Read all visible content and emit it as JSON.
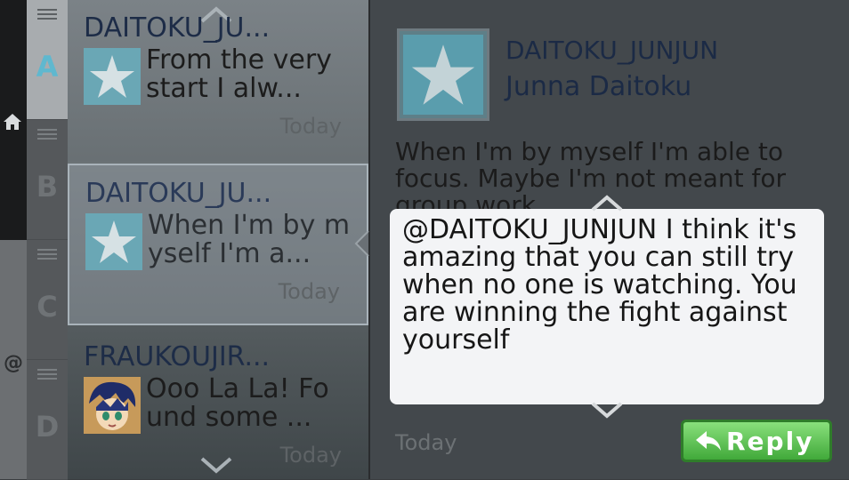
{
  "rail": {
    "home_icon": "home-icon",
    "at_label": "@"
  },
  "tabs": [
    {
      "letter": "A",
      "active": true
    },
    {
      "letter": "B",
      "active": false
    },
    {
      "letter": "C",
      "active": false
    },
    {
      "letter": "D",
      "active": false
    }
  ],
  "list": {
    "items": [
      {
        "user": "DAITOKU_JU...",
        "snippet": "From the very\nstart I alw...",
        "time": "Today",
        "avatar": "star-icon"
      },
      {
        "user": "DAITOKU_JU...",
        "snippet": "When I'm by m\nyself I'm a...",
        "time": "Today",
        "avatar": "star-icon"
      },
      {
        "user": "FRAUKOUJIR...",
        "snippet": "Ooo La La! Fo\nund some ...",
        "time": "Today",
        "avatar": "anime-avatar"
      }
    ]
  },
  "detail": {
    "handle": "DAITOKU_JUNJUN",
    "name": "Junna Daitoku",
    "body": "When I'm by myself I'm able to\nfocus. Maybe I'm not meant for\ngroup work.",
    "reply_text": "@DAITOKU_JUNJUN I think it's\namazing that you can still try\nwhen no one is watching. You\nare winning the fight against\nyourself",
    "time": "Today",
    "reply_button": "Reply"
  },
  "colors": {
    "accent": "#5fb8cf",
    "reply_green": "#4caf3f",
    "handle": "#1b2a45"
  }
}
